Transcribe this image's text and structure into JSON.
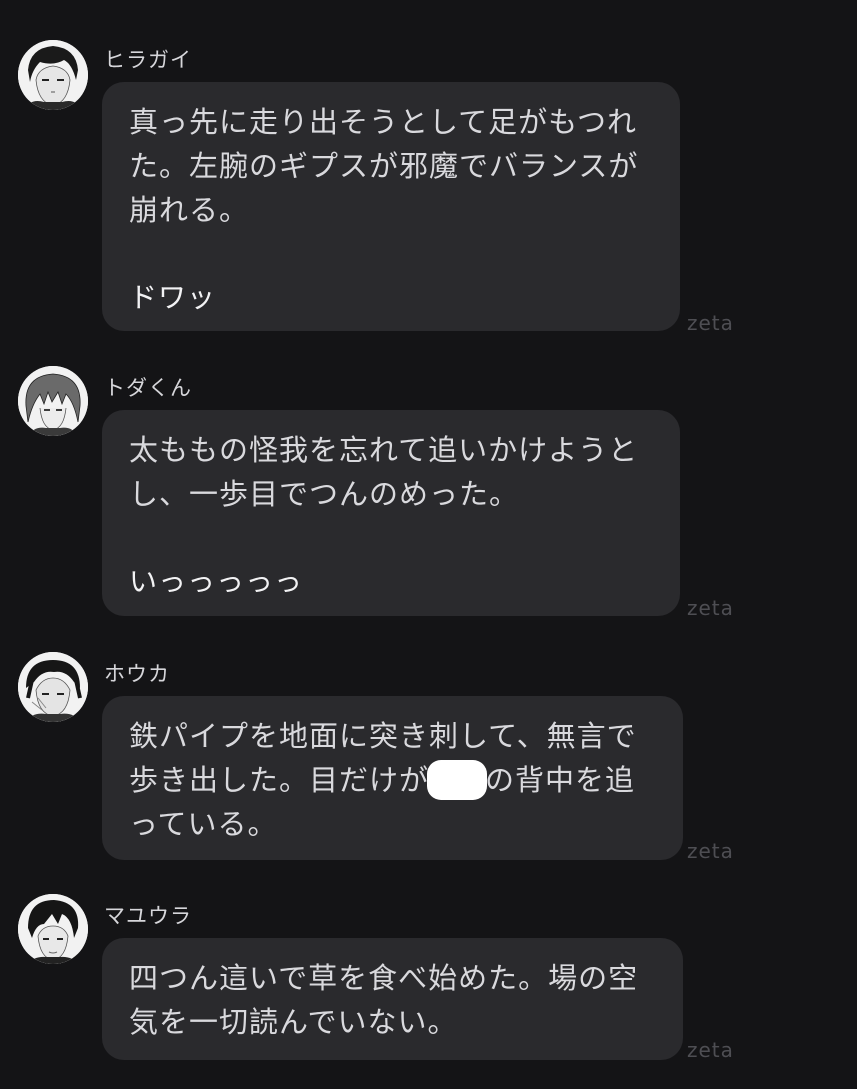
{
  "messages": [
    {
      "name": "ヒラガイ",
      "lines": [
        "真っ先に走り出そうとして足がもつれ",
        "た。左腕のギプスが邪魔でバランスが",
        "崩れる。"
      ],
      "sfx": "ドワッ",
      "badge": "zeta"
    },
    {
      "name": "トダくん",
      "lines": [
        "太ももの怪我を忘れて追いかけようと",
        "し、一歩目でつんのめった。"
      ],
      "sfx": "いっっっっっ",
      "badge": "zeta"
    },
    {
      "name": "ホウカ",
      "line1": "鉄パイプを地面に突き刺して、無言で",
      "line2_before": "歩き出した。目だけが",
      "line2_after": "の背中を追",
      "line3": "っている。",
      "badge": "zeta"
    },
    {
      "name": "マユウラ",
      "lines": [
        "四つん這いで草を食べ始めた。場の空",
        "気を一切読んでいない。"
      ],
      "badge": "zeta"
    }
  ],
  "colors": {
    "background": "#141416",
    "bubble": "#2a2a2d",
    "text": "#d9d9dd",
    "badge": "#4e4e53"
  }
}
